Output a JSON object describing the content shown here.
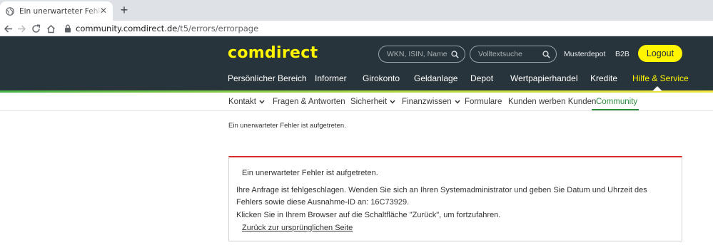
{
  "browser": {
    "tab_title": "Ein unerwarteter Fehler ist aufgetreten",
    "tab_close": "✕",
    "new_tab": "+",
    "url_host": "community.comdirect.de",
    "url_path": "/t5/errors/errorpage"
  },
  "header": {
    "logo": "comdirect",
    "search_placeholder": "WKN, ISIN, Name",
    "fulltext_placeholder": "Volltextsuche",
    "musterdepot": "Musterdepot",
    "b2b": "B2B",
    "logout": "Logout",
    "accent_color": "#fff500",
    "bg_color": "#28343b"
  },
  "main_nav": [
    {
      "label": "Persönlicher Bereich"
    },
    {
      "label": "Informer"
    },
    {
      "label": "Girokonto"
    },
    {
      "label": "Geldanlage"
    },
    {
      "label": "Depot"
    },
    {
      "label": "Wertpapierhandel"
    },
    {
      "label": "Kredite"
    },
    {
      "label": "Hilfe & Service",
      "active": true
    }
  ],
  "sub_nav": [
    {
      "label": "Kontakt",
      "dropdown": true
    },
    {
      "label": "Fragen & Antworten"
    },
    {
      "label": "Sicherheit",
      "dropdown": true
    },
    {
      "label": "Finanzwissen",
      "dropdown": true
    },
    {
      "label": "Formulare"
    },
    {
      "label": "Kunden werben Kunden"
    },
    {
      "label": "Community",
      "active": true
    }
  ],
  "page": {
    "message": "Ein unerwarteter Fehler ist aufgetreten."
  },
  "error_box": {
    "title": "Ein unerwarteter Fehler ist aufgetreten.",
    "line1": "Ihre Anfrage ist fehlgeschlagen. Wenden Sie sich an Ihren Systemadministrator und geben Sie Datum und Uhrzeit des",
    "line2": "Fehlers sowie diese Ausnahme-ID an: 16C73929.",
    "line3": "Klicken Sie in Ihrem Browser auf die Schaltfläche \"Zurück\", um fortzufahren.",
    "back_link": "Zurück zur ursprünglichen Seite",
    "border_color": "#d62b2b"
  }
}
